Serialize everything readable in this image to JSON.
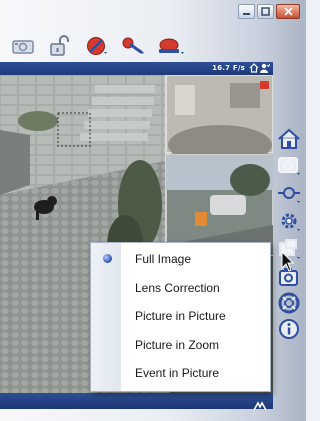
{
  "status": {
    "fps": "16.7 F/s"
  },
  "menu": {
    "items": [
      {
        "label": "Full Image",
        "selected": true
      },
      {
        "label": "Lens Correction",
        "selected": false
      },
      {
        "label": "Picture in Picture",
        "selected": false
      },
      {
        "label": "Picture in Zoom",
        "selected": false
      },
      {
        "label": "Event in Picture",
        "selected": false
      }
    ]
  },
  "toolbar": {
    "icons": [
      "camera-icon",
      "padlock-open-icon",
      "no-recording-icon",
      "microphone-icon",
      "alarm-light-icon"
    ]
  },
  "sidebar": {
    "icons": [
      "home-icon",
      "image-quality-icon",
      "playback-icon",
      "settings-gear-icon",
      "display-mode-icon",
      "snapshot-icon",
      "help-lifebuoy-icon",
      "info-icon"
    ]
  },
  "colors": {
    "accent": "#1f3b7d",
    "menu_bg": "#ffffff",
    "selected_dot": "#2a4fb5"
  }
}
